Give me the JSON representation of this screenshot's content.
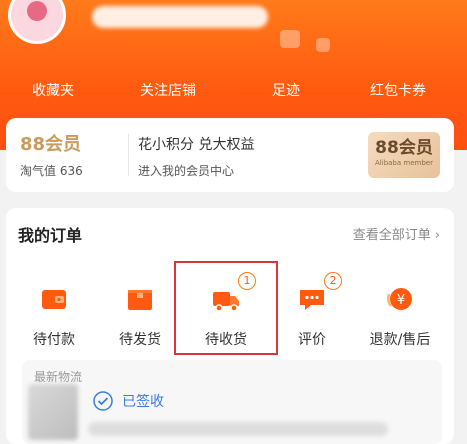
{
  "quick_nav": {
    "items": [
      {
        "label": "收藏夹"
      },
      {
        "label": "关注店铺"
      },
      {
        "label": "足迹"
      },
      {
        "label": "红包卡券"
      }
    ]
  },
  "member": {
    "badge": "88会员",
    "taoqi": "淘气值 636",
    "title": "花小积分 兑大权益",
    "subtitle": "进入我的会员中心",
    "logo_big": "88会员",
    "logo_small": "Alibaba member"
  },
  "orders": {
    "title": "我的订单",
    "view_all": "查看全部订单",
    "items": [
      {
        "label": "待付款",
        "icon": "wallet-icon",
        "badge": ""
      },
      {
        "label": "待发货",
        "icon": "package-icon",
        "badge": ""
      },
      {
        "label": "待收货",
        "icon": "truck-icon",
        "badge": "1"
      },
      {
        "label": "评价",
        "icon": "comment-icon",
        "badge": "2"
      },
      {
        "label": "退款/售后",
        "icon": "refund-icon",
        "badge": ""
      }
    ]
  },
  "logistics": {
    "label": "最新物流",
    "status": "已签收"
  },
  "colors": {
    "accent": "#ff5a10",
    "gold": "#c99a5c",
    "status_blue": "#3a7be0",
    "highlight_red": "#d9353c"
  }
}
